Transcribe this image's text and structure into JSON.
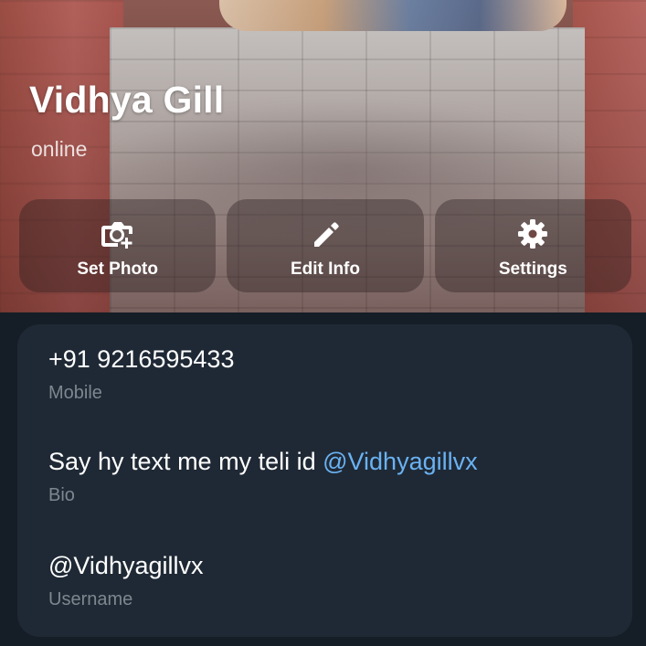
{
  "profile": {
    "name": "Vidhya Gill",
    "status": "online"
  },
  "actions": [
    {
      "label": "Set Photo",
      "icon": "camera-add-icon"
    },
    {
      "label": "Edit Info",
      "icon": "pencil-icon"
    },
    {
      "label": "Settings",
      "icon": "gear-icon"
    }
  ],
  "info": {
    "mobile": {
      "value": "+91 9216595433",
      "label": "Mobile"
    },
    "bio": {
      "text": "Say hy text me my teli id ",
      "mention": "@Vidhyagillvx",
      "label": "Bio"
    },
    "username": {
      "value": "@Vidhyagillvx",
      "label": "Username"
    }
  },
  "colors": {
    "background": "#151d26",
    "card": "#1f2935",
    "secondary_text": "#7d8790",
    "link": "#6ab2f2",
    "button_bg": "rgba(40,30,30,0.38)"
  }
}
